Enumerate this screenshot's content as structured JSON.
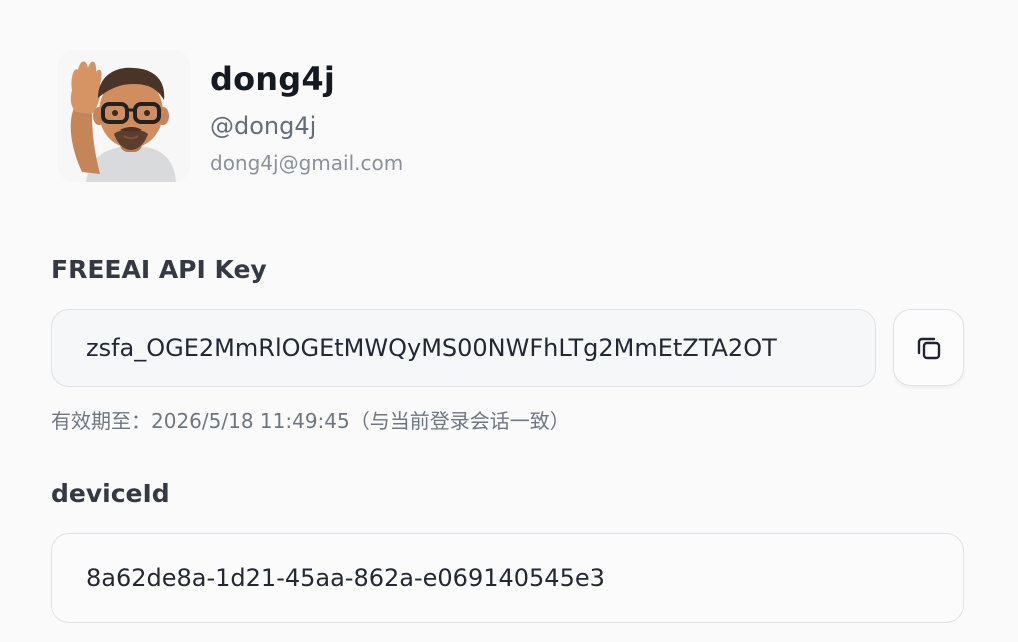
{
  "profile": {
    "name": "dong4j",
    "handle": "@dong4j",
    "email": "dong4j@gmail.com",
    "avatar_icon": "waving-memoji-avatar"
  },
  "api_key": {
    "label": "FREEAI API Key",
    "value": "zsfa_OGE2MmRlOGEtMWQyMS00NWFhLTg2MmEtZTA2OT",
    "copy_icon": "copy-icon",
    "expiry": "有效期至：2026/5/18 11:49:45（与当前登录会话一致）"
  },
  "device": {
    "label": "deviceId",
    "value": "8a62de8a-1d21-45aa-862a-e069140545e3"
  }
}
